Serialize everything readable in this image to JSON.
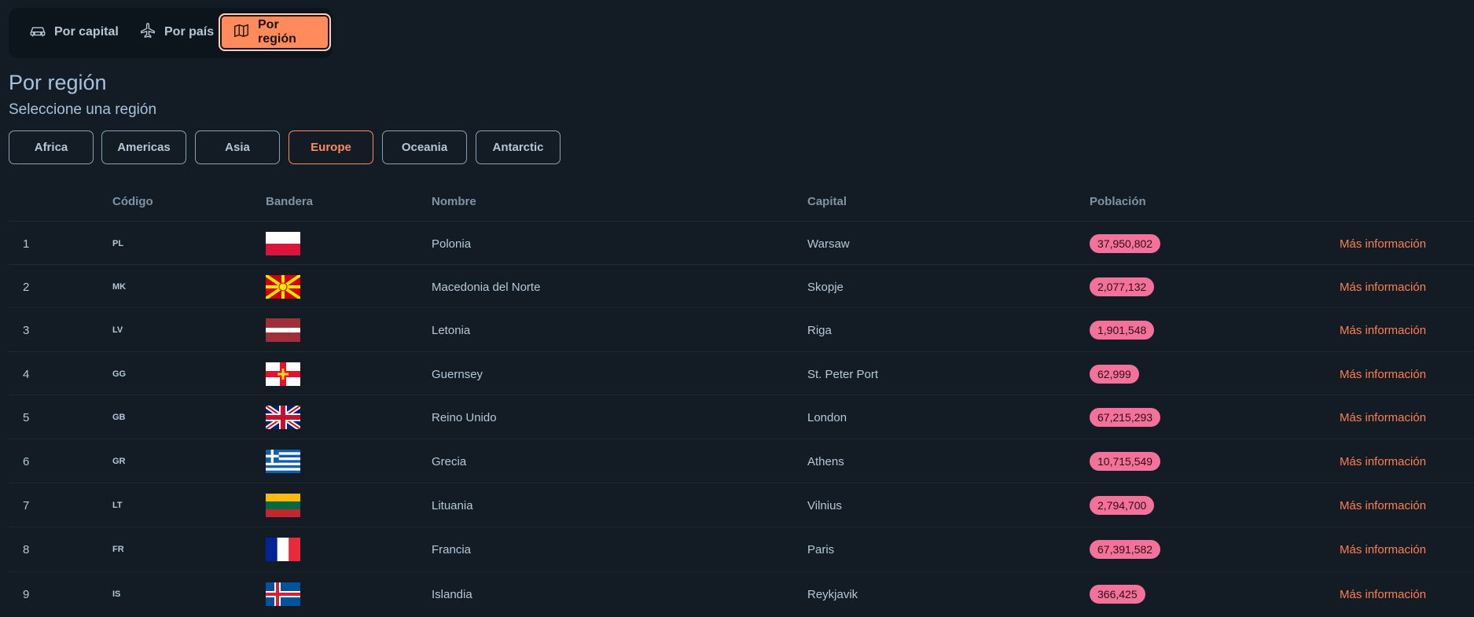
{
  "nav": {
    "items": [
      {
        "label": "Por capital",
        "icon": "car-icon"
      },
      {
        "label": "Por país",
        "icon": "plane-icon"
      },
      {
        "label": "Por región",
        "icon": "map-icon",
        "active": true
      }
    ]
  },
  "header": {
    "title": "Por región",
    "subtitle": "Seleccione una región"
  },
  "regions": [
    {
      "label": "Africa"
    },
    {
      "label": "Americas"
    },
    {
      "label": "Asia"
    },
    {
      "label": "Europe",
      "active": true
    },
    {
      "label": "Oceania"
    },
    {
      "label": "Antarctic"
    }
  ],
  "table": {
    "headers": [
      "Código",
      "Bandera",
      "Nombre",
      "Capital",
      "Población"
    ],
    "more_label": "Más información",
    "rows": [
      {
        "index": "1",
        "code": "PL",
        "flag": "pl-flag",
        "name": "Polonia",
        "capital": "Warsaw",
        "population": "37,950,802"
      },
      {
        "index": "2",
        "code": "MK",
        "flag": "mk-flag",
        "name": "Macedonia del Norte",
        "capital": "Skopje",
        "population": "2,077,132"
      },
      {
        "index": "3",
        "code": "LV",
        "flag": "lv-flag",
        "name": "Letonia",
        "capital": "Riga",
        "population": "1,901,548"
      },
      {
        "index": "4",
        "code": "GG",
        "flag": "gg-flag",
        "name": "Guernsey",
        "capital": "St. Peter Port",
        "population": "62,999"
      },
      {
        "index": "5",
        "code": "GB",
        "flag": "gb-flag",
        "name": "Reino Unido",
        "capital": "London",
        "population": "67,215,293"
      },
      {
        "index": "6",
        "code": "GR",
        "flag": "gr-flag",
        "name": "Grecia",
        "capital": "Athens",
        "population": "10,715,549"
      },
      {
        "index": "7",
        "code": "LT",
        "flag": "lt-flag",
        "name": "Lituania",
        "capital": "Vilnius",
        "population": "2,794,700"
      },
      {
        "index": "8",
        "code": "FR",
        "flag": "fr-flag",
        "name": "Francia",
        "capital": "Paris",
        "population": "67,391,582"
      },
      {
        "index": "9",
        "code": "IS",
        "flag": "is-flag",
        "name": "Islandia",
        "capital": "Reykjavik",
        "population": "366,425"
      }
    ]
  },
  "colors": {
    "accent": "#ff8a5c",
    "badge": "#f4729a",
    "background": "#131c24"
  }
}
